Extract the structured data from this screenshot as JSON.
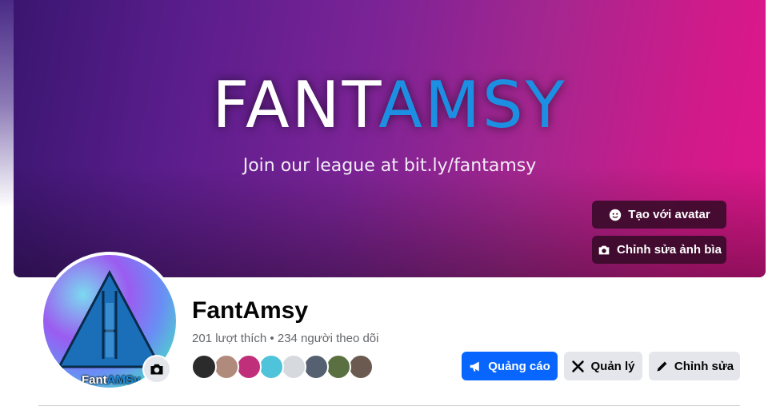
{
  "cover": {
    "brand_white": "FANT",
    "brand_blue": "AMS",
    "brand_white_end": "Y",
    "tagline": "Join our league at bit.ly/fantamsy",
    "avatar_button": "Tạo với avatar",
    "edit_cover_button": "Chỉnh sửa ảnh bìa"
  },
  "profile": {
    "logo_white": "Fant",
    "logo_blue": "AMSy",
    "name": "FantAmsy",
    "stats": "201 lượt thích • 234 người theo dõi"
  },
  "followers": [
    {
      "color": "#2b2b2b"
    },
    {
      "color": "#b08a7a"
    },
    {
      "color": "#c0307a"
    },
    {
      "color": "#4fc3d9"
    },
    {
      "color": "#d6d9de"
    },
    {
      "color": "#556070"
    },
    {
      "color": "#5a7040"
    },
    {
      "color": "#6a5a50"
    }
  ],
  "actions": {
    "ads": "Quảng cáo",
    "manage": "Quản lý",
    "edit": "Chỉnh sửa"
  },
  "colors": {
    "primary": "#0866ff",
    "secondary_bg": "#e4e6eb",
    "cover_start": "#3a1670",
    "cover_end": "#e0168c"
  }
}
